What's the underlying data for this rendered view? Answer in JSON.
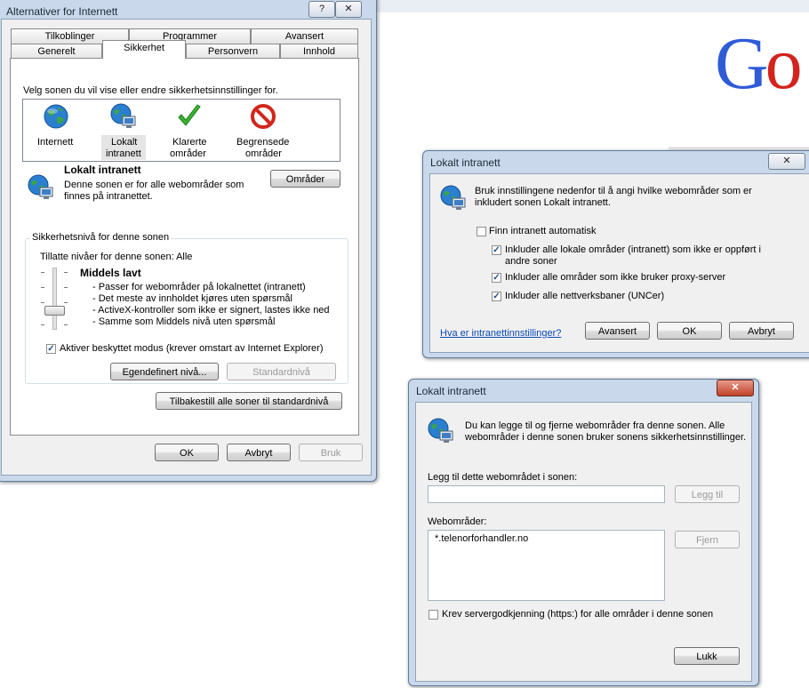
{
  "background": {
    "google_left": "G",
    "google_right": "o"
  },
  "options_dialog": {
    "title": "Alternativer for Internett",
    "help_btn": "?",
    "close_btn": "✕",
    "tabs_row1": [
      "Tilkoblinger",
      "Programmer",
      "Avansert"
    ],
    "tabs_row2": [
      "Generelt",
      "Sikkerhet",
      "Personvern",
      "Innhold"
    ],
    "zone_prompt": "Velg sonen du vil vise eller endre sikkerhetsinnstillinger for.",
    "zones": [
      {
        "label1": "Internett",
        "label2": ""
      },
      {
        "label1": "Lokalt",
        "label2": "intranett"
      },
      {
        "label1": "Klarerte",
        "label2": "områder"
      },
      {
        "label1": "Begrensede",
        "label2": "områder"
      }
    ],
    "zone_title": "Lokalt intranett",
    "zone_desc1": "Denne sonen er for alle webområder som",
    "zone_desc2": "finnes på intranettet.",
    "sites_btn": "Områder",
    "group_title": "Sikkerhetsnivå for denne sonen",
    "allowed_levels": "Tillatte nivåer for denne sonen: Alle",
    "level_name": "Middels lavt",
    "level_items": [
      "- Passer for webområder på lokalnettet (intranett)",
      "- Det meste av innholdet kjøres uten spørsmål",
      "- ActiveX-kontroller som ikke er signert, lastes ikke ned",
      "- Samme som Middels nivå uten spørsmål"
    ],
    "protected_mode": "Aktiver beskyttet modus (krever omstart av Internet Explorer)",
    "protected_checked": "✓",
    "custom_btn": "Egendefinert nivå...",
    "default_btn": "Standardnivå",
    "reset_btn": "Tilbakestill alle soner til standardnivå",
    "ok_btn": "OK",
    "cancel_btn": "Avbryt",
    "apply_btn": "Bruk"
  },
  "intranet_dialog": {
    "title": "Lokalt intranett",
    "close_btn": "✕",
    "desc1": "Bruk innstillingene nedenfor til å angi hvilke webområder som er",
    "desc2": "inkludert sonen Lokalt intranett.",
    "auto_detect": "Finn intranett automatisk",
    "opt1_line1": "Inkluder alle lokale områder (intranett) som ikke er oppført i",
    "opt1_line2": "andre soner",
    "opt2": "Inkluder alle områder som ikke bruker proxy-server",
    "opt3": "Inkluder alle nettverksbaner (UNCer)",
    "checked": "✓",
    "help_link": "Hva er intranettinnstillinger?",
    "advanced_btn": "Avansert",
    "ok_btn": "OK",
    "cancel_btn": "Avbryt"
  },
  "sites_dialog": {
    "title": "Lokalt intranett",
    "close_btn": "✕",
    "desc1": "Du kan legge til og fjerne webområder fra denne sonen. Alle",
    "desc2": "webområder i denne sonen bruker sonens sikkerhetsinnstillinger.",
    "add_label": "Legg til dette webområdet i sonen:",
    "add_value": "",
    "add_btn": "Legg til",
    "list_label": "Webområder:",
    "sites": [
      "*.telenorforhandler.no"
    ],
    "remove_btn": "Fjern",
    "https_label": "Krev servergodkjenning (https:) for alle områder i denne sonen",
    "close_action": "Lukk"
  },
  "colors": {
    "frame": "#c9d8ea",
    "link": "#0a4ab8"
  }
}
